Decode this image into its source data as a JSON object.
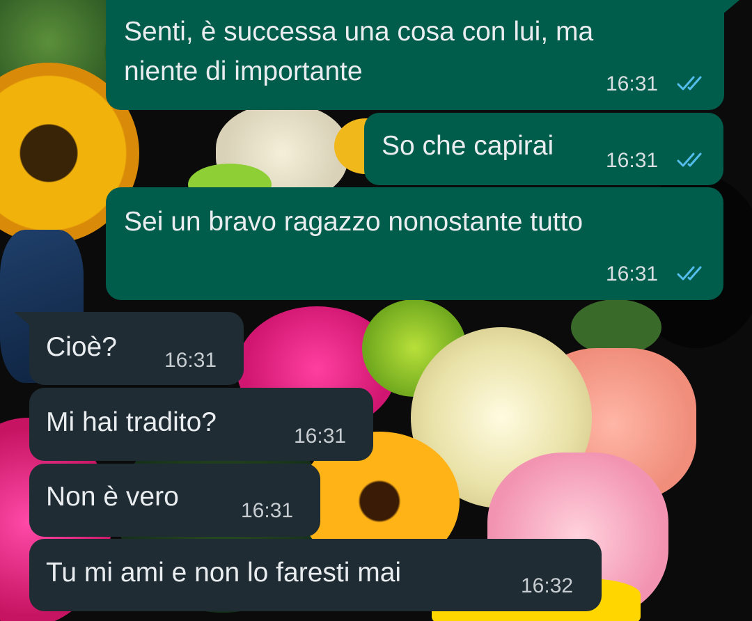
{
  "messages": [
    {
      "direction": "outgoing",
      "text_lines": [
        "Senti, è successa una cosa con lui, ma",
        "niente di importante"
      ],
      "time": "16:31",
      "status": "read"
    },
    {
      "direction": "outgoing",
      "text_lines": [
        "So che capirai"
      ],
      "time": "16:31",
      "status": "read"
    },
    {
      "direction": "outgoing",
      "text_lines": [
        "Sei un bravo ragazzo nonostante tutto"
      ],
      "time": "16:31",
      "status": "read"
    },
    {
      "direction": "incoming",
      "text_lines": [
        "Cioè?"
      ],
      "time": "16:31"
    },
    {
      "direction": "incoming",
      "text_lines": [
        "Mi hai tradito?"
      ],
      "time": "16:31"
    },
    {
      "direction": "incoming",
      "text_lines": [
        "Non è vero"
      ],
      "time": "16:31"
    },
    {
      "direction": "incoming",
      "text_lines": [
        "Tu mi ami e non lo faresti mai"
      ],
      "time": "16:32"
    }
  ],
  "colors": {
    "outgoing_bubble": "#005c4b",
    "incoming_bubble": "#1f2c34",
    "read_tick": "#53bdeb",
    "text": "#e9edef"
  },
  "icons": {
    "read_receipt": "double-check-icon"
  }
}
